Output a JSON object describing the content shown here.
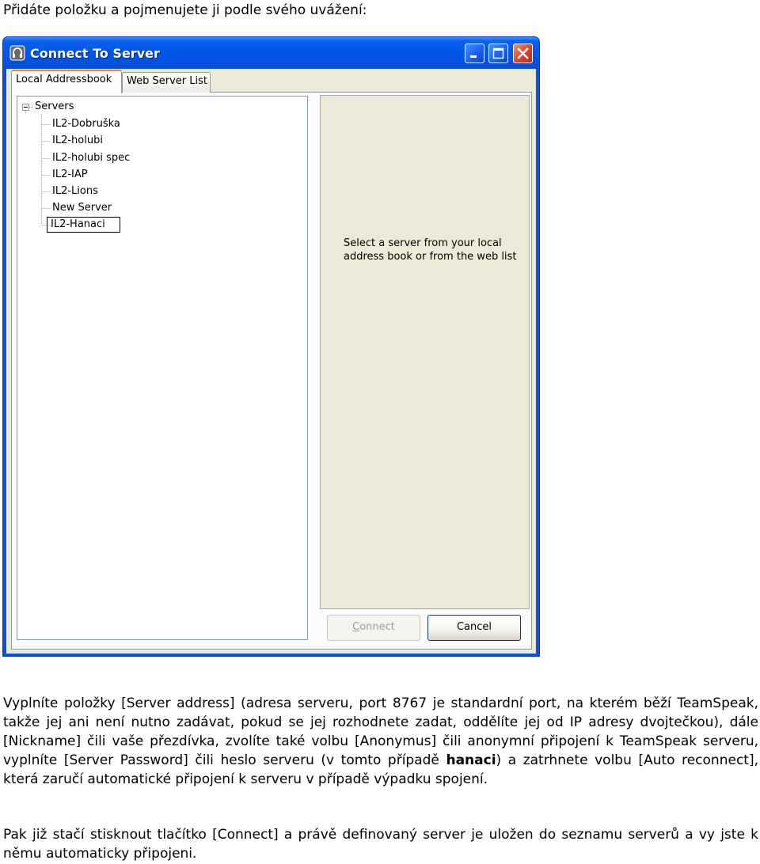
{
  "intro": "Přidáte položku a pojmenujete ji podle svého uvážení:",
  "window": {
    "title": "Connect To Server",
    "tabs": [
      {
        "label": "Local Addressbook",
        "active": true
      },
      {
        "label": "Web Server List",
        "active": false
      }
    ],
    "tree": {
      "root": "Servers",
      "items": [
        "IL2-Dobruška",
        "IL2-holubi",
        "IL2-holubi spec",
        "IL2-IAP",
        "IL2-Lions",
        "New Server",
        "IL2-Hanaci"
      ],
      "selected_item": "IL2-Hanaci"
    },
    "info_text": "Select a server from your local address book or from the web list",
    "buttons": {
      "connect_first": "C",
      "connect_rest": "onnect",
      "cancel": "Cancel"
    },
    "title_buttons": [
      "minimize-icon",
      "maximize-icon",
      "close-icon"
    ],
    "colors": {
      "titlebar": "#0058e6",
      "face": "#ece9d8",
      "tab_highlight": "#e68b2c"
    }
  },
  "paragraph1": {
    "before_bold": "Vyplníte položky [Server address] (adresa serveru, port 8767 je standardní port, na kterém běží TeamSpeak, takže jej ani není nutno zadávat, pokud se jej rozhodnete zadat, oddělíte jej od IP adresy dvojtečkou), dále [Nickname] čili vaše přezdívka, zvolíte také volbu [Anonymus] čili anonymní připojení k TeamSpeak serveru, vyplníte [Server Password] čili heslo serveru (v tomto případě ",
    "bold": "hanaci",
    "after_bold": ") a zatrhnete volbu [Auto reconnect], která zaručí automatické připojení k serveru v případě výpadku spojení."
  },
  "paragraph2": "Pak již stačí stisknout tlačítko [Connect] a právě definovaný server je uložen do seznamu serverů a vy jste k němu automaticky připojeni."
}
